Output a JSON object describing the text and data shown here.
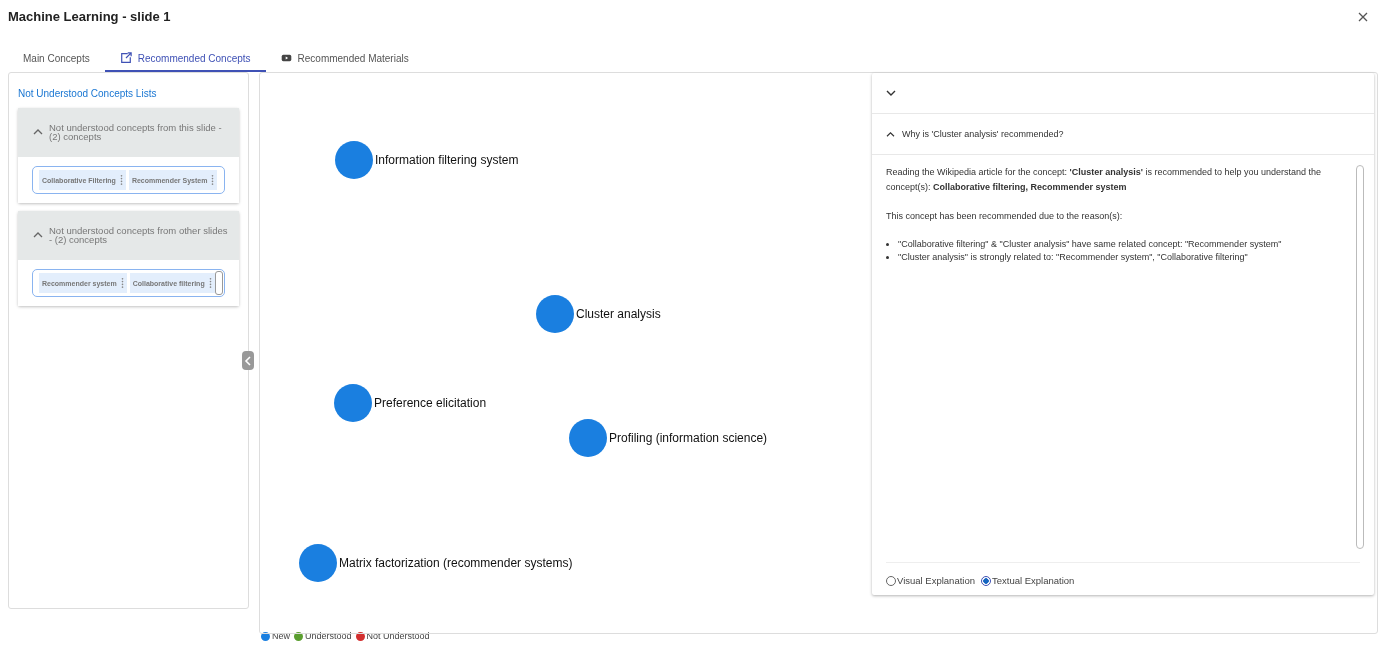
{
  "window": {
    "title": "Machine Learning - slide 1"
  },
  "tabs": [
    {
      "label": "Main Concepts",
      "selected": false,
      "kind": "plain"
    },
    {
      "label": "Recommended Concepts",
      "selected": true,
      "kind": "external"
    },
    {
      "label": "Recommended Materials",
      "selected": false,
      "kind": "video"
    }
  ],
  "sidebar": {
    "heading": "Not Understood Concepts Lists",
    "sections": [
      {
        "title": "Not understood concepts from this slide - (2) concepts",
        "expanded": true,
        "chips": [
          "Collaborative Filtering",
          "Recommender System"
        ]
      },
      {
        "title": "Not understood concepts from other slides - (2) concepts",
        "expanded": true,
        "chips": [
          "Recommender system",
          "Collaborative filtering"
        ]
      }
    ]
  },
  "graph": {
    "nodes": [
      {
        "label": "Information filtering system",
        "color": "#1a7fe0"
      },
      {
        "label": "Cluster analysis",
        "color": "#1a7fe0"
      },
      {
        "label": "Preference elicitation",
        "color": "#1a7fe0"
      },
      {
        "label": "Profiling (information science)",
        "color": "#1a7fe0"
      },
      {
        "label": "Matrix factorization (recommender systems)",
        "color": "#1a7fe0"
      }
    ]
  },
  "explanation": {
    "collapsed_header_expanded": false,
    "question": "Why is 'Cluster analysis' recommended?",
    "expanded": true,
    "paragraph": "Reading the Wikipedia article for the concept: **'Cluster analysis'** is recommended to help you understand the concept(s): **Collaborative filtering, Recommender system**",
    "reasons_intro": "This concept has been recommended due to the reason(s):",
    "reasons": [
      "\"Collaborative filtering\" & \"Cluster analysis\" have same related concept: \"Recommender system\"",
      "\"Cluster analysis\" is strongly related to: \"Recommender system\", \"Collaborative filtering\""
    ],
    "options": [
      {
        "label": "Visual Explanation",
        "selected": false
      },
      {
        "label": "Textual Explanation",
        "selected": true
      }
    ]
  },
  "legend": [
    {
      "label": "New",
      "color": "#1a7fe0"
    },
    {
      "label": "Understood",
      "color": "#5a9e2f"
    },
    {
      "label": "Not Understood",
      "color": "#d32f2f"
    }
  ]
}
